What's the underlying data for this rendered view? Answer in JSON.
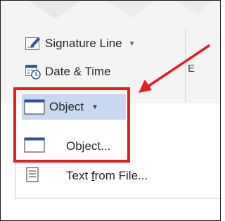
{
  "ribbon": {
    "signature_line": {
      "label": "Signature Line",
      "icon": "signature-line-icon"
    },
    "date_time": {
      "label": "Date & Time",
      "icon": "date-time-icon"
    },
    "object_button": {
      "label": "Object",
      "icon": "object-icon"
    },
    "group_label_fragment": "E"
  },
  "menu": {
    "items": [
      {
        "label": "Object...",
        "icon": "object-icon"
      },
      {
        "label_before": "Text ",
        "label_underlined": "f",
        "label_after": "rom File...",
        "icon": "text-file-icon"
      }
    ]
  },
  "colors": {
    "annotation_red": "#e31e24",
    "object_button_highlight": "#c6d9f0",
    "icon_blue": "#2b579a",
    "ribbon_background": "#f4f4f4"
  }
}
